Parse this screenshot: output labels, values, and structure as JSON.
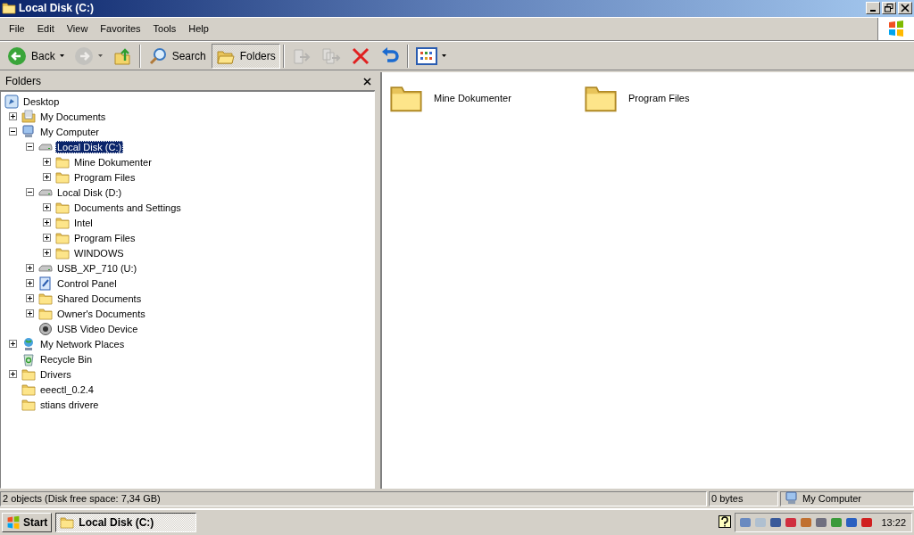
{
  "window": {
    "title": "Local Disk (C:)"
  },
  "menu": [
    "File",
    "Edit",
    "View",
    "Favorites",
    "Tools",
    "Help"
  ],
  "toolbar": [
    {
      "kind": "back",
      "label": "Back",
      "disabled": false,
      "pressed": false,
      "dropdown": true
    },
    {
      "kind": "forward",
      "disabled": true,
      "pressed": false,
      "dropdown": true
    },
    {
      "kind": "up",
      "disabled": false,
      "pressed": false,
      "dropdown": false
    },
    {
      "kind": "separator"
    },
    {
      "kind": "search",
      "label": "Search",
      "disabled": false,
      "pressed": false,
      "dropdown": false
    },
    {
      "kind": "folders",
      "label": "Folders",
      "disabled": false,
      "pressed": true,
      "dropdown": false
    },
    {
      "kind": "separator"
    },
    {
      "kind": "move",
      "disabled": true,
      "pressed": false,
      "dropdown": false
    },
    {
      "kind": "copy",
      "disabled": true,
      "pressed": false,
      "dropdown": false
    },
    {
      "kind": "delete",
      "disabled": false,
      "pressed": false,
      "dropdown": false
    },
    {
      "kind": "undo",
      "disabled": false,
      "pressed": false,
      "dropdown": false
    },
    {
      "kind": "separator"
    },
    {
      "kind": "views",
      "disabled": false,
      "pressed": false,
      "dropdown": true
    }
  ],
  "folders_pane": {
    "title": "Folders",
    "tree": [
      {
        "label": "Desktop",
        "kind": "desktop",
        "selected": false,
        "children": [
          {
            "label": "My Documents",
            "kind": "documents",
            "expandable": true,
            "expanded": false,
            "selected": false
          },
          {
            "label": "My Computer",
            "kind": "computer",
            "expandable": true,
            "expanded": true,
            "selected": false,
            "children": [
              {
                "label": "Local Disk (C:)",
                "kind": "drive",
                "expandable": true,
                "expanded": true,
                "selected": true,
                "children": [
                  {
                    "label": "Mine Dokumenter",
                    "kind": "folder",
                    "expandable": true,
                    "expanded": false,
                    "selected": false
                  },
                  {
                    "label": "Program Files",
                    "kind": "folder",
                    "expandable": true,
                    "expanded": false,
                    "selected": false
                  }
                ]
              },
              {
                "label": "Local Disk (D:)",
                "kind": "drive",
                "expandable": true,
                "expanded": true,
                "selected": false,
                "children": [
                  {
                    "label": "Documents and Settings",
                    "kind": "folder",
                    "expandable": true,
                    "expanded": false,
                    "selected": false
                  },
                  {
                    "label": "Intel",
                    "kind": "folder",
                    "expandable": true,
                    "expanded": false,
                    "selected": false
                  },
                  {
                    "label": "Program Files",
                    "kind": "folder",
                    "expandable": true,
                    "expanded": false,
                    "selected": false
                  },
                  {
                    "label": "WINDOWS",
                    "kind": "folder",
                    "expandable": true,
                    "expanded": false,
                    "selected": false
                  }
                ]
              },
              {
                "label": "USB_XP_710 (U:)",
                "kind": "drive",
                "expandable": true,
                "expanded": false,
                "selected": false
              },
              {
                "label": "Control Panel",
                "kind": "control-panel",
                "expandable": true,
                "expanded": false,
                "selected": false
              },
              {
                "label": "Shared Documents",
                "kind": "folder",
                "expandable": true,
                "expanded": false,
                "selected": false
              },
              {
                "label": "Owner's Documents",
                "kind": "folder",
                "expandable": true,
                "expanded": false,
                "selected": false
              },
              {
                "label": "USB Video Device",
                "kind": "camera",
                "selected": false
              }
            ]
          },
          {
            "label": "My Network Places",
            "kind": "network",
            "expandable": true,
            "expanded": false,
            "selected": false
          },
          {
            "label": "Recycle Bin",
            "kind": "recycle",
            "selected": false
          },
          {
            "label": "Drivers",
            "kind": "folder",
            "expandable": true,
            "expanded": false,
            "selected": false
          },
          {
            "label": "eeectl_0.2.4",
            "kind": "folder",
            "selected": false
          },
          {
            "label": "stians drivere",
            "kind": "folder",
            "selected": false
          }
        ]
      }
    ]
  },
  "files": [
    {
      "name": "Mine Dokumenter",
      "selected": false
    },
    {
      "name": "Program Files",
      "selected": false
    }
  ],
  "status_bar": {
    "objects": "2 objects (Disk free space: 7,34 GB)",
    "size": "0 bytes",
    "zone": "My Computer"
  },
  "taskbar": {
    "start": "Start",
    "tasks": [
      {
        "label": "Local Disk (C:)",
        "selected": true
      }
    ],
    "clock": "13:22"
  }
}
